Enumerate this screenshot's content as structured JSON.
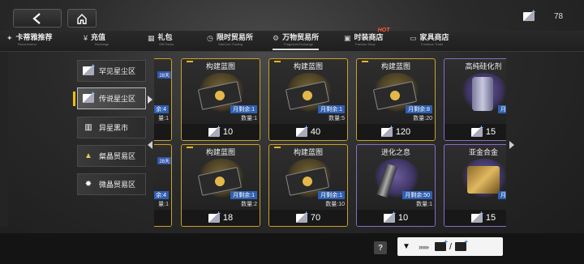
{
  "topbar": {
    "back_icon": "back-arrow-icon",
    "home_icon": "home-icon",
    "currency_value": "78"
  },
  "tabs": [
    {
      "label": "卡蒂雅推荐",
      "sub": "Recommend",
      "icon": "star-icon"
    },
    {
      "label": "充值",
      "sub": "Recharge",
      "icon": "yen-icon"
    },
    {
      "label": "礼包",
      "sub": "Gift Packs",
      "icon": "gift-icon"
    },
    {
      "label": "限时贸易所",
      "sub": "StarCoin Trading",
      "icon": "clock-icon"
    },
    {
      "label": "万物贸易所",
      "sub": "Fragment Exchange",
      "icon": "gear-icon"
    },
    {
      "label": "时装商店",
      "sub": "Fashion Shop",
      "icon": "shirt-icon",
      "badge": "HOT"
    },
    {
      "label": "家具商店",
      "sub": "Furniture Trade",
      "icon": "sofa-icon"
    }
  ],
  "subnav": [
    {
      "label": "罕见星尘区",
      "icon": "chip-icon"
    },
    {
      "label": "传说星尘区",
      "icon": "chip-icon"
    },
    {
      "label": "异星黑市",
      "icon": "market-icon"
    },
    {
      "label": "粲晶贸易区",
      "icon": "triangle-crystal-icon"
    },
    {
      "label": "微晶贸易区",
      "icon": "spiky-crystal-icon"
    }
  ],
  "cards": [
    {
      "name": "",
      "limit": "余:4",
      "qty": "量:1",
      "price": "10",
      "rarity": "gold",
      "art": "ticket",
      "tag": "28天"
    },
    {
      "name": "构建蓝图",
      "limit": "月剩余:1",
      "qty": "数量:1",
      "price": "10",
      "rarity": "gold",
      "art": "ticket"
    },
    {
      "name": "构建蓝图",
      "limit": "月剩余:1",
      "qty": "数量:5",
      "price": "40",
      "rarity": "gold",
      "art": "ticket"
    },
    {
      "name": "构建蓝图",
      "limit": "月剩余:8",
      "qty": "数量:20",
      "price": "120",
      "rarity": "gold",
      "art": "ticket"
    },
    {
      "name": "高纯硅化剂",
      "limit": "月剩余",
      "qty": "数量",
      "price": "15",
      "rarity": "purple",
      "art": "canister"
    },
    {
      "name": "",
      "limit": "余:4",
      "qty": "量:1",
      "price": "",
      "rarity": "gold",
      "art": "ticket",
      "tag": "28天"
    },
    {
      "name": "构建蓝图",
      "limit": "月剩余:1",
      "qty": "数量:2",
      "price": "18",
      "rarity": "gold",
      "art": "ticket"
    },
    {
      "name": "构建蓝图",
      "limit": "月剩余:1",
      "qty": "数量:10",
      "price": "70",
      "rarity": "gold",
      "art": "ticket"
    },
    {
      "name": "进化之息",
      "limit": "月剩余:50",
      "qty": "数量:1",
      "price": "10",
      "rarity": "purple",
      "art": "rod"
    },
    {
      "name": "亚金合金",
      "limit": "月剩余",
      "qty": "数量",
      "price": "15",
      "rarity": "purple",
      "art": "crate"
    }
  ],
  "footer": {
    "help": "?",
    "exchange_arrows": "››››››"
  },
  "colors": {
    "gold_border": "#c9a22b",
    "purple_border": "#8b6cc9",
    "limit_badge": "#2f5fb0",
    "hot": "#ff5a3a"
  }
}
